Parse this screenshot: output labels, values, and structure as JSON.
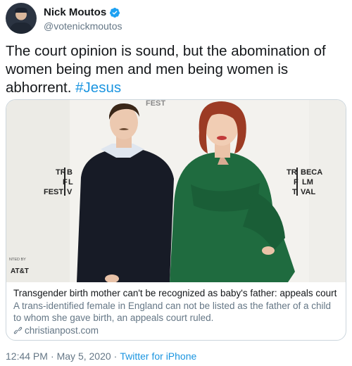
{
  "author": {
    "name": "Nick Moutos",
    "handle": "@votenickmoutos",
    "avatar_icon": "profile-photo",
    "verified_icon": "verified-badge-icon"
  },
  "tweet": {
    "text": "The court opinion is sound, but the abomination of women being men and men being women is abhorrent.",
    "hashtag": "#Jesus"
  },
  "card": {
    "title": "Transgender birth mother can't be recognized as baby's father: appeals court",
    "description": "A trans-identified female in England can not be listed as the father of a child to whom she gave birth, an appeals court ruled.",
    "domain": "christianpost.com",
    "backdrop": {
      "left_logo": [
        "TR",
        "B",
        "F",
        "L",
        "FEST",
        "V"
      ],
      "right_logo": [
        "TR",
        "BECA",
        "F",
        "LM",
        "T",
        "VAL"
      ],
      "top_logo": "FEST",
      "sponsor_small": "NTED BY",
      "sponsor": "AT&T"
    }
  },
  "meta": {
    "time": "12:44 PM",
    "separator": "·",
    "date": "May 5, 2020",
    "source": "Twitter for iPhone"
  },
  "colors": {
    "link": "#1b95e0",
    "secondary_text": "#657786",
    "border": "#ccd6dd"
  }
}
